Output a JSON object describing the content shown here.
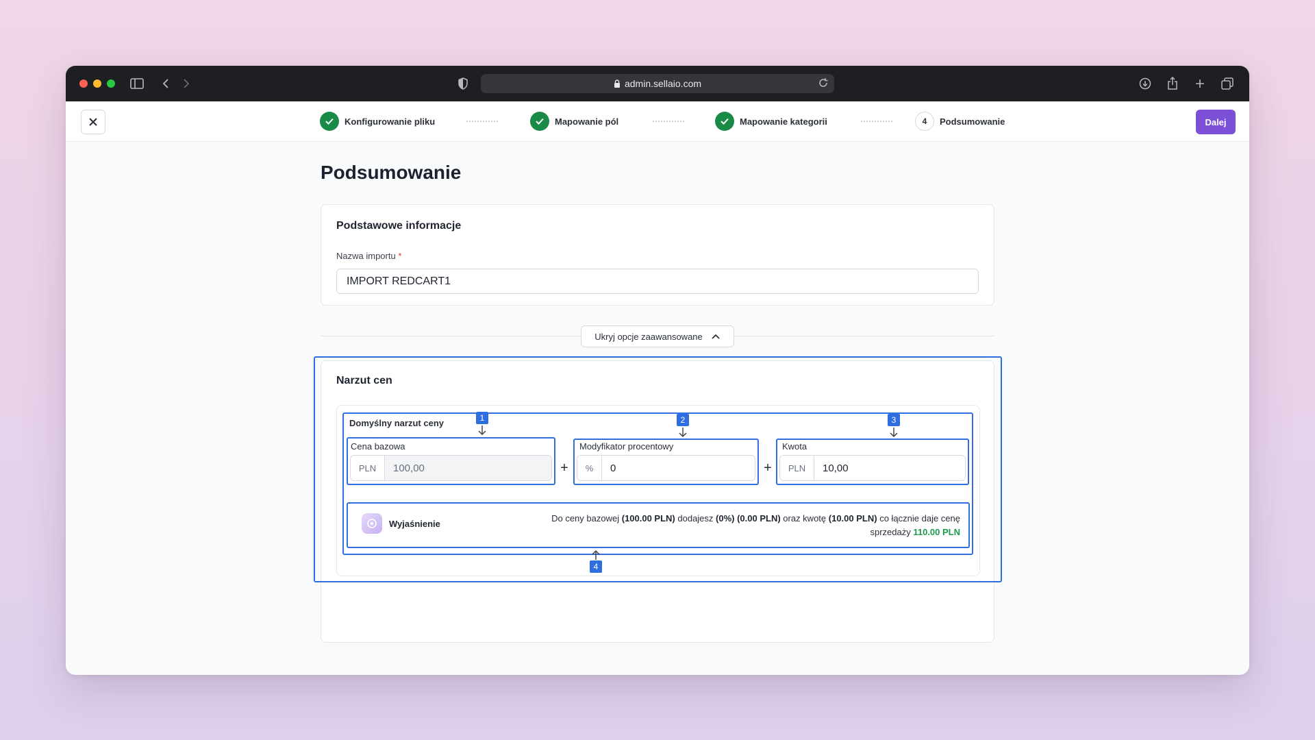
{
  "browser": {
    "url": "admin.sellaio.com"
  },
  "wizard": {
    "steps": [
      {
        "label": "Konfigurowanie pliku",
        "status": "done"
      },
      {
        "label": "Mapowanie pól",
        "status": "done"
      },
      {
        "label": "Mapowanie kategorii",
        "status": "done"
      },
      {
        "label": "Podsumowanie",
        "status": "current",
        "number": "4"
      }
    ],
    "next_label": "Dalej"
  },
  "page": {
    "title": "Podsumowanie"
  },
  "basic_info": {
    "title": "Podstawowe informacje",
    "name_label": "Nazwa importu",
    "required_mark": "*",
    "name_value": "IMPORT REDCART1"
  },
  "advanced": {
    "toggle_label": "Ukryj opcje zaawansowane"
  },
  "markup": {
    "title": "Narzut cen",
    "group_label": "Domyślny narzut ceny",
    "base_price": {
      "label": "Cena bazowa",
      "addon": "PLN",
      "value": "100,00"
    },
    "percent_modifier": {
      "label": "Modyfikator procentowy",
      "addon": "%",
      "value": "0"
    },
    "amount": {
      "label": "Kwota",
      "addon": "PLN",
      "value": "10,00"
    },
    "plus_sign": "+",
    "explanation": {
      "title": "Wyjaśnienie",
      "t1": "Do ceny bazowej ",
      "b1": "(100.00 PLN)",
      "t2": " dodajesz ",
      "b2": "(0%) (0.00 PLN)",
      "t3": " oraz kwotę ",
      "b3": "(10.00 PLN)",
      "t4": " co łącznie daje cenę sprzedaży ",
      "total": "110.00 PLN"
    },
    "annotations": [
      "1",
      "2",
      "3",
      "4"
    ]
  },
  "colors": {
    "accent": "#7b4fd6",
    "success": "#1a8a47",
    "highlight": "#2f6ee0"
  }
}
